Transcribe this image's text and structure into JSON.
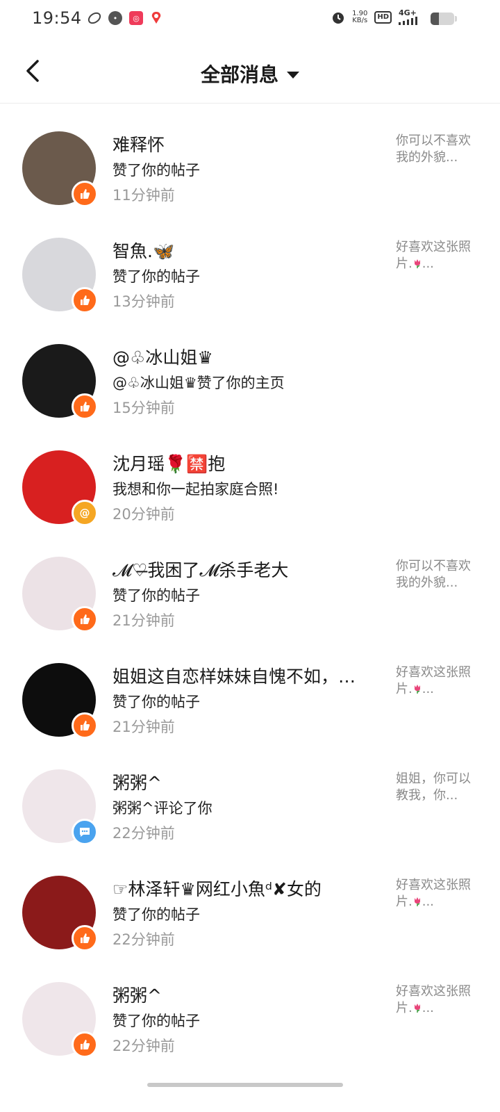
{
  "status": {
    "time": "19:54",
    "speed_value": "1.90",
    "speed_unit": "KB/s",
    "hd": "HD",
    "network": "4G+"
  },
  "header": {
    "title": "全部消息"
  },
  "messages": [
    {
      "name": "难释怀",
      "action": "赞了你的帖子",
      "time": "11分钟前",
      "badge": "like",
      "preview_before": "你可以不喜欢我的外貌...",
      "preview_after": "",
      "avatar_color": "#6b5a4c"
    },
    {
      "name": "智魚.🦋",
      "action": "赞了你的帖子",
      "time": "13分钟前",
      "badge": "like",
      "preview_before": "好喜欢这张照片.",
      "preview_after": "...",
      "avatar_color": "#d8d8dc"
    },
    {
      "name": "@♧冰山姐♛",
      "action": "@♧冰山姐♛赞了你的主页",
      "time": "15分钟前",
      "badge": "like",
      "preview_before": "",
      "preview_after": "",
      "avatar_color": "#1a1a1a"
    },
    {
      "name": "沈月瑶🌹🈲抱",
      "action": "我想和你一起拍家庭合照!",
      "time": "20分钟前",
      "badge": "at",
      "preview_before": "",
      "preview_after": "",
      "avatar_color": "#d82020"
    },
    {
      "name": "𝓜♡̶我困了𝓜杀手老大",
      "action": "赞了你的帖子",
      "time": "21分钟前",
      "badge": "like",
      "preview_before": "你可以不喜欢我的外貌...",
      "preview_after": "",
      "avatar_color": "#ece2e6"
    },
    {
      "name": "姐姐这自恋样妹妹自愧不如，…",
      "action": "赞了你的帖子",
      "time": "21分钟前",
      "badge": "like",
      "preview_before": "好喜欢这张照片.",
      "preview_after": "...",
      "avatar_color": "#0d0d0d"
    },
    {
      "name": "粥粥^",
      "action": "粥粥^评论了你",
      "time": "22分钟前",
      "badge": "comment",
      "preview_before": "姐姐，你可以教我，你...",
      "preview_after": "",
      "avatar_color": "#efe6ea"
    },
    {
      "name": "☞林泽轩♛网红小魚ᵈ✘女的",
      "action": "赞了你的帖子",
      "time": "22分钟前",
      "badge": "like",
      "preview_before": "好喜欢这张照片.",
      "preview_after": "...",
      "avatar_color": "#8b1a1a"
    },
    {
      "name": "粥粥^",
      "action": "赞了你的帖子",
      "time": "22分钟前",
      "badge": "like",
      "preview_before": "好喜欢这张照片.",
      "preview_after": "...",
      "avatar_color": "#efe6ea"
    }
  ]
}
